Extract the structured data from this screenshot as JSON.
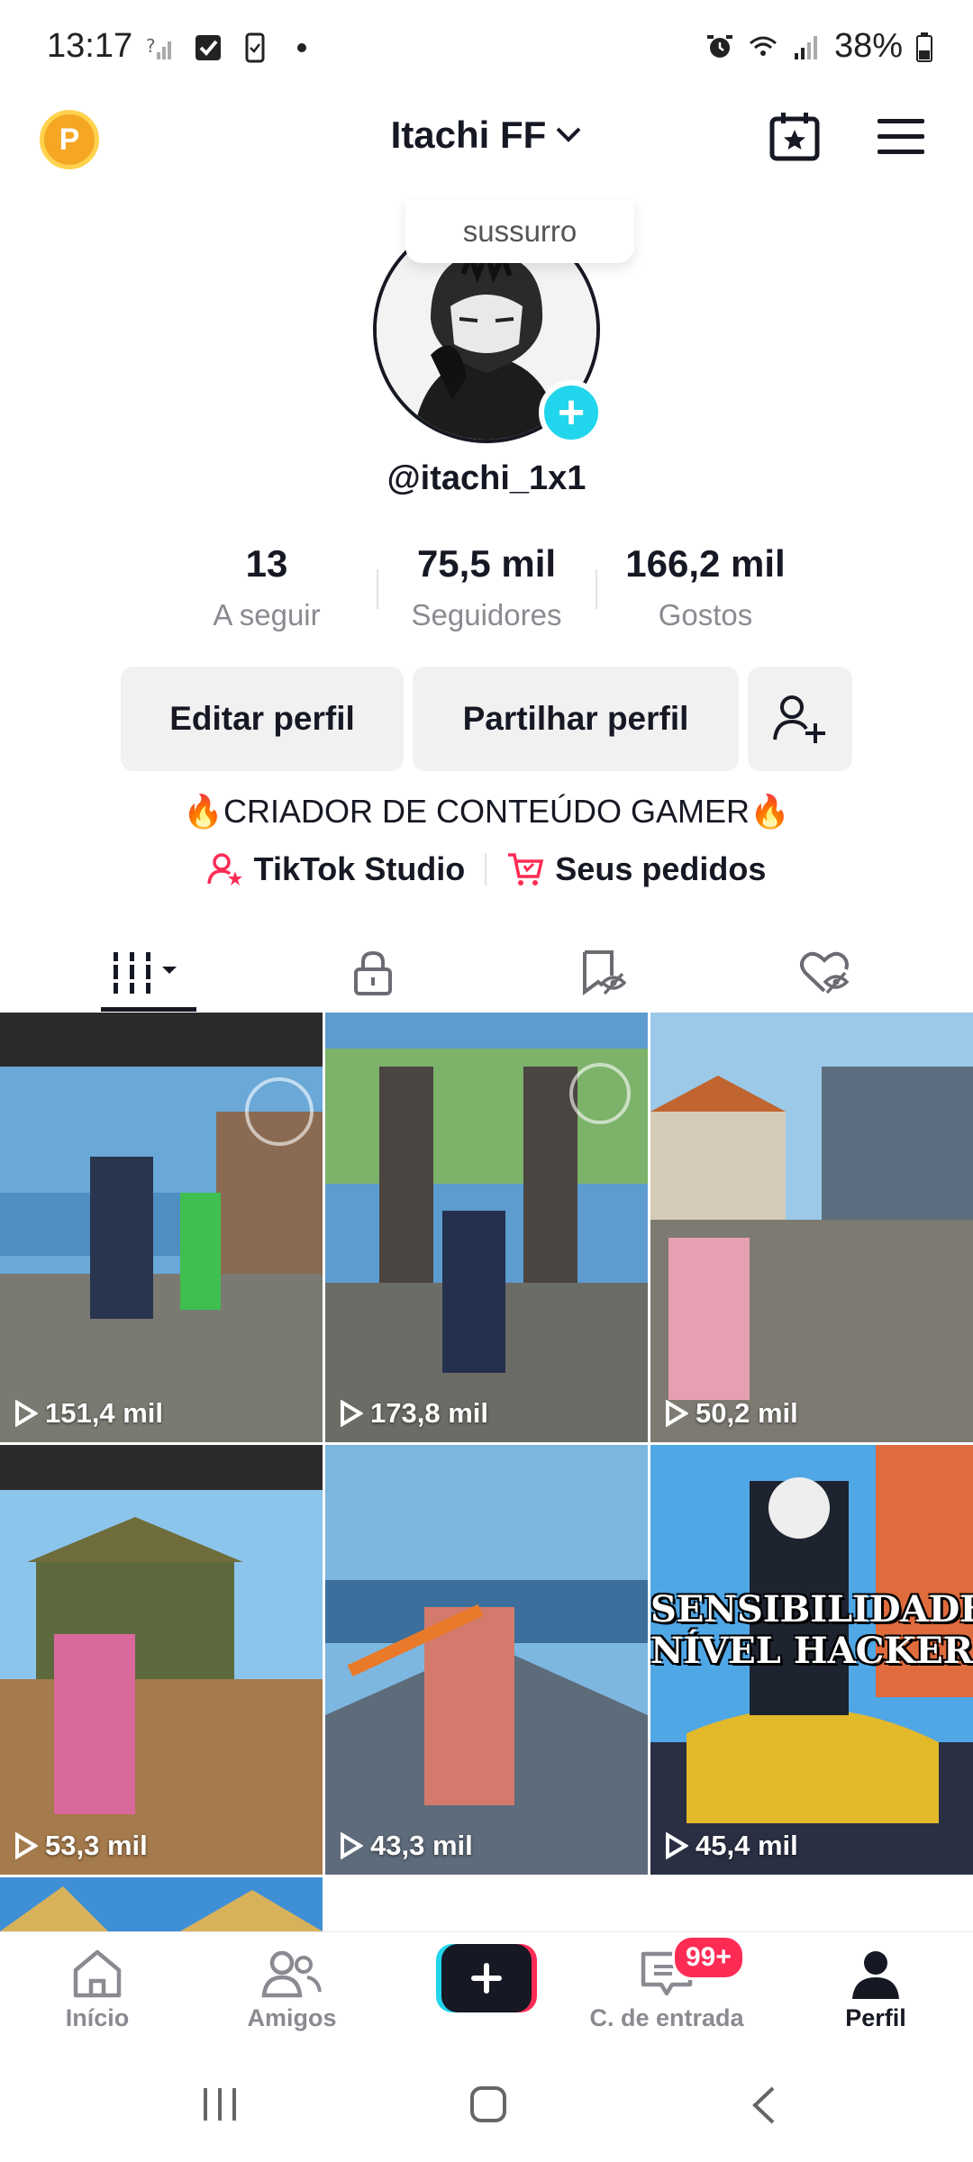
{
  "status": {
    "time": "13:17",
    "battery": "38%"
  },
  "header": {
    "points_letter": "P",
    "title": "Itachi FF",
    "bubble_text": "sussurro"
  },
  "profile": {
    "username": "@itachi_1x1",
    "stats": [
      {
        "value": "13",
        "label": "A seguir"
      },
      {
        "value": "75,5 mil",
        "label": "Seguidores"
      },
      {
        "value": "166,2 mil",
        "label": "Gostos"
      }
    ],
    "buttons": {
      "edit": "Editar perfil",
      "share": "Partilhar perfil"
    },
    "bio": "🔥CRIADOR DE CONTEÚDO GAMER🔥",
    "links": {
      "studio": "TikTok Studio",
      "orders": "Seus pedidos"
    }
  },
  "tabs": [
    "videos-grid-icon",
    "lock-icon",
    "saved-icon",
    "liked-icon"
  ],
  "videos": [
    {
      "views": "151,4 mil"
    },
    {
      "views": "173,8 mil"
    },
    {
      "views": "50,2 mil"
    },
    {
      "views": "53,3 mil"
    },
    {
      "views": "43,3 mil"
    },
    {
      "views": "45,4 mil",
      "overlay": "SENSIBILIDADE NÍVEL HACKER"
    }
  ],
  "nav": {
    "home": "Início",
    "friends": "Amigos",
    "inbox": "C. de entrada",
    "inbox_badge": "99+",
    "profile": "Perfil"
  },
  "colors": {
    "accent_red": "#fe2c55",
    "accent_cyan": "#20d5ec",
    "text_primary": "#161823",
    "text_secondary": "#8a8b91"
  }
}
